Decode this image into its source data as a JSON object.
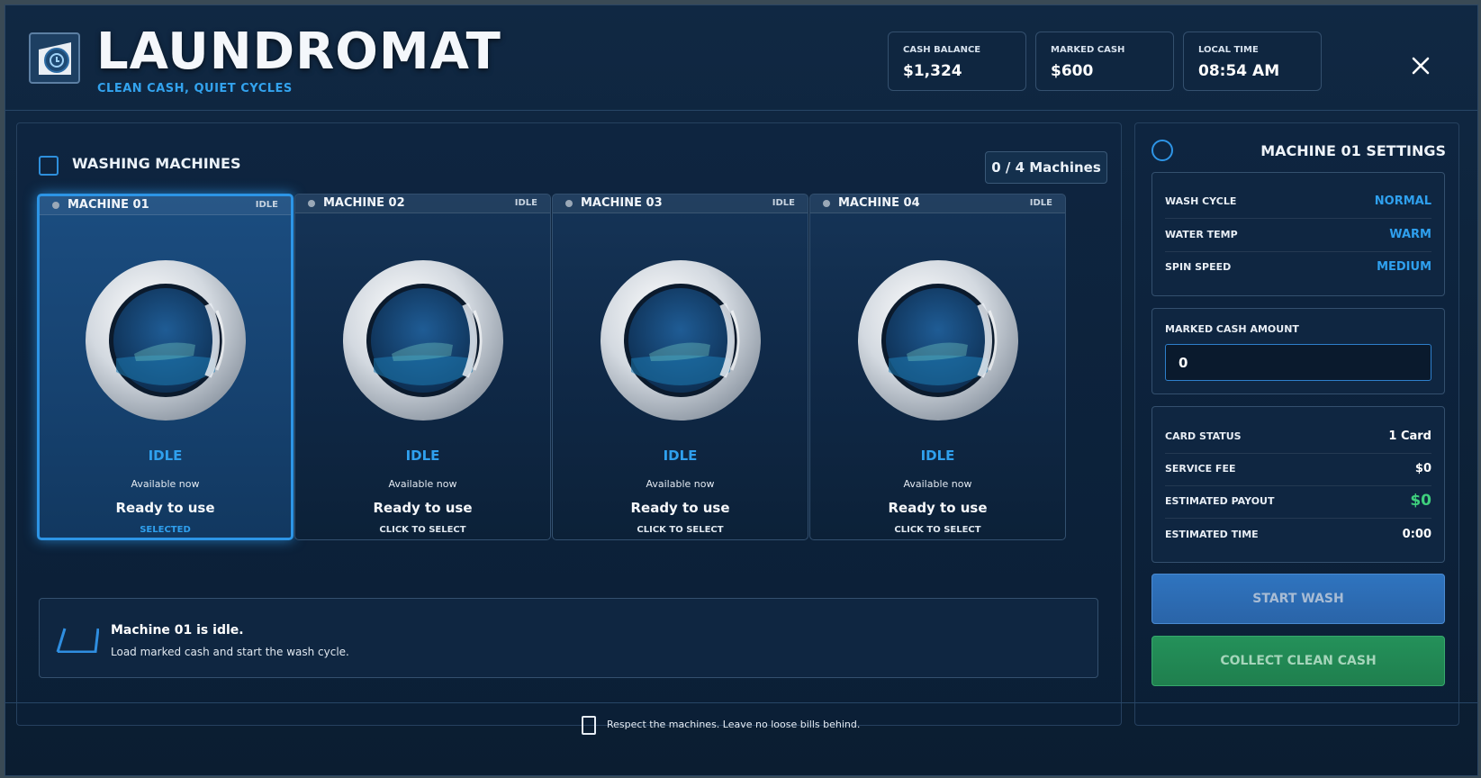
{
  "header": {
    "title": "LAUNDROMAT",
    "subtitle": "CLEAN CASH, QUIET CYCLES",
    "stats": [
      {
        "label": "CASH BALANCE",
        "value": "$1,324"
      },
      {
        "label": "MARKED CASH",
        "value": "$600"
      },
      {
        "label": "LOCAL TIME",
        "value": "08:54 AM"
      }
    ],
    "close_icon": "close-icon"
  },
  "machines_section": {
    "title": "WASHING MACHINES",
    "count": "0 / 4 Machines",
    "machines": [
      {
        "name": "MACHINE 01",
        "state": "IDLE",
        "status": "IDLE",
        "availability": "Available now",
        "ready": "Ready to use",
        "action": "SELECTED",
        "selected": true
      },
      {
        "name": "MACHINE 02",
        "state": "IDLE",
        "status": "IDLE",
        "availability": "Available now",
        "ready": "Ready to use",
        "action": "CLICK TO SELECT",
        "selected": false
      },
      {
        "name": "MACHINE 03",
        "state": "IDLE",
        "status": "IDLE",
        "availability": "Available now",
        "ready": "Ready to use",
        "action": "CLICK TO SELECT",
        "selected": false
      },
      {
        "name": "MACHINE 04",
        "state": "IDLE",
        "status": "IDLE",
        "availability": "Available now",
        "ready": "Ready to use",
        "action": "CLICK TO SELECT",
        "selected": false
      }
    ]
  },
  "notice": {
    "title": "Machine 01 is idle.",
    "body": "Load marked cash and start the wash cycle.",
    "icon": "basket-icon"
  },
  "settings": {
    "title": "MACHINE 01 SETTINGS",
    "rows": [
      {
        "label": "WASH CYCLE",
        "value": "NORMAL"
      },
      {
        "label": "WATER TEMP",
        "value": "WARM"
      },
      {
        "label": "SPIN SPEED",
        "value": "MEDIUM"
      }
    ],
    "amount_label": "MARKED CASH AMOUNT",
    "amount_value": "0",
    "summary": [
      {
        "label": "CARD STATUS",
        "value": "1 Card"
      },
      {
        "label": "SERVICE FEE",
        "value": "$0"
      },
      {
        "label": "ESTIMATED PAYOUT",
        "value": "$0"
      },
      {
        "label": "ESTIMATED TIME",
        "value": "0:00"
      }
    ],
    "start_label": "START WASH",
    "collect_label": "COLLECT CLEAN CASH"
  },
  "footer": {
    "text": "Respect the machines. Leave no loose bills behind.",
    "icon": "phone-icon"
  },
  "colors": {
    "accent": "#2fa0ee",
    "payout": "#3fd07d",
    "start_button": "#2f74bf",
    "collect_button": "#24915a"
  }
}
